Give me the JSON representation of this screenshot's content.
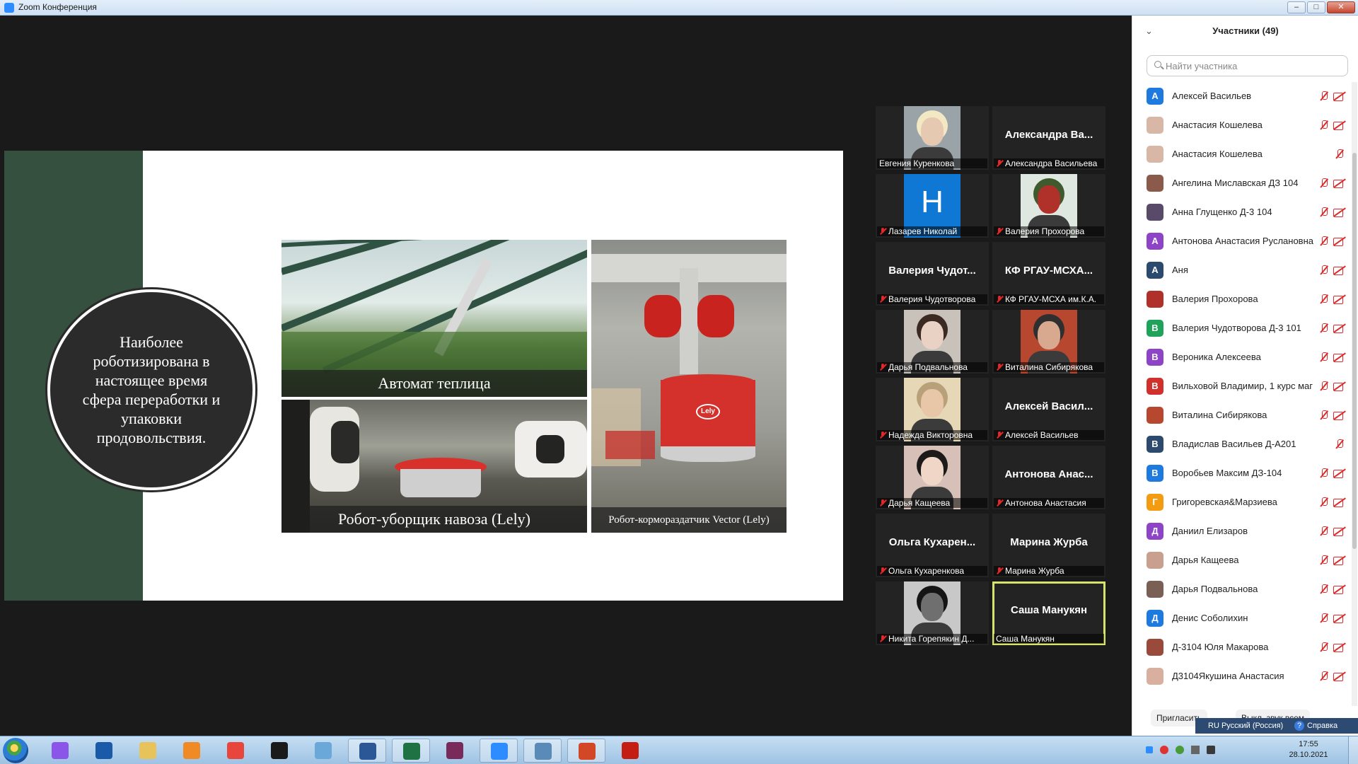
{
  "window": {
    "title": "Zoom Конференция",
    "controls": [
      "–",
      "□",
      "✕"
    ]
  },
  "slide": {
    "circle_text": "Наиболее роботизирована в настоящее время сфера переработки и упаковки продовольствия.",
    "captions": {
      "greenhouse": "Автомат теплица",
      "manure": "Робот-уборщик навоза (Lely)",
      "feeder": "Робот-кормораздатчик Vector (Lely)"
    },
    "feeder_logo": "Lely"
  },
  "gallery": [
    {
      "big": "",
      "small": "Евгения Куренкова",
      "muted": false,
      "video": true,
      "bg": "#9aa3a8",
      "face": "#e5c9b0",
      "hair": "#f2e8c4"
    },
    {
      "big": "Александра Ва...",
      "small": "Александра Васильева",
      "muted": true,
      "video": false
    },
    {
      "big": "",
      "small": "Лазарев Николай",
      "muted": true,
      "video": true,
      "letter": "H",
      "bg": "#0e78d4"
    },
    {
      "big": "",
      "small": "Валерия Прохорова",
      "muted": true,
      "video": true,
      "bg": "#dfe7e1",
      "face": "#b0312a",
      "hair": "#3f5a2c"
    },
    {
      "big": "Валерия Чудот...",
      "small": "Валерия Чудотворова",
      "muted": true,
      "video": false
    },
    {
      "big": "КФ РГАУ-МСХА...",
      "small": "КФ РГАУ-МСХА им.К.А.",
      "muted": true,
      "video": false
    },
    {
      "big": "",
      "small": "Дарья Подвальнова",
      "muted": true,
      "video": true,
      "bg": "#c9c2bb",
      "face": "#e9d2c3",
      "hair": "#3a2a22"
    },
    {
      "big": "",
      "small": "Виталина Сибирякова",
      "muted": true,
      "video": true,
      "bg": "#b7482f",
      "face": "#d8a88f",
      "hair": "#2f2f2f"
    },
    {
      "big": "",
      "small": "Надежда Викторовна",
      "muted": true,
      "video": true,
      "bg": "#e6d7b6",
      "face": "#e8c6a8",
      "hair": "#b7a07a"
    },
    {
      "big": "Алексей Васил...",
      "small": "Алексей Васильев",
      "muted": true,
      "video": false
    },
    {
      "big": "",
      "small": "Дарья Кащеева",
      "muted": true,
      "video": true,
      "bg": "#d7c0b8",
      "face": "#efd6c6",
      "hair": "#1d1a1a"
    },
    {
      "big": "Антонова Анас...",
      "small": "Антонова Анастасия",
      "muted": true,
      "video": false
    },
    {
      "big": "Ольга Кухарен...",
      "small": "Ольга Кухаренкова",
      "muted": true,
      "video": false
    },
    {
      "big": "Марина Журба",
      "small": "Марина Журба",
      "muted": true,
      "video": false
    },
    {
      "big": "",
      "small": "Никита Горепякин Д...",
      "muted": true,
      "video": true,
      "bg": "#c8c8c8",
      "face": "#6f6f6f",
      "hair": "#151515"
    },
    {
      "big": "Саша Манукян",
      "small": "Саша Манукян",
      "muted": false,
      "video": false,
      "active": true
    }
  ],
  "participants_panel": {
    "title": "Участники (49)",
    "search_placeholder": "Найти участника",
    "items": [
      {
        "initial": "А",
        "color": "#1f7ae0",
        "name": "Алексей Васильев",
        "cam_off": true
      },
      {
        "initial": "",
        "color": "#d8b7a7",
        "name": "Анастасия Кошелева",
        "cam_off": true
      },
      {
        "initial": "",
        "color": "#d8b7a7",
        "name": "Анастасия Кошелева",
        "cam_off": false
      },
      {
        "initial": "",
        "color": "#8a5a4a",
        "name": "Ангелина Миславская ДЗ 104",
        "cam_off": true
      },
      {
        "initial": "",
        "color": "#5a4a6a",
        "name": "Анна Глущенко Д-3 104",
        "cam_off": true
      },
      {
        "initial": "А",
        "color": "#8e44c6",
        "name": "Антонова Анастасия Руслановна",
        "cam_off": true
      },
      {
        "initial": "А",
        "color": "#2c4a6e",
        "name": "Аня",
        "cam_off": true
      },
      {
        "initial": "",
        "color": "#b0312a",
        "name": "Валерия Прохорова",
        "cam_off": true
      },
      {
        "initial": "В",
        "color": "#1fa25a",
        "name": "Валерия Чудотворова Д-3 101",
        "cam_off": true
      },
      {
        "initial": "В",
        "color": "#8e44c6",
        "name": "Вероника Алексеева",
        "cam_off": true
      },
      {
        "initial": "В",
        "color": "#d0312d",
        "name": "Вильховой Владимир, 1 курс маг",
        "cam_off": true
      },
      {
        "initial": "",
        "color": "#b7482f",
        "name": "Виталина Сибирякова",
        "cam_off": true
      },
      {
        "initial": "В",
        "color": "#2c4a6e",
        "name": "Владислав Васильев Д-А201",
        "cam_off": false
      },
      {
        "initial": "В",
        "color": "#1f7ae0",
        "name": "Воробьев Максим ДЗ-104",
        "cam_off": true
      },
      {
        "initial": "Г",
        "color": "#f39c12",
        "name": "Григоревская&Марзиева",
        "cam_off": true
      },
      {
        "initial": "Д",
        "color": "#8e44c6",
        "name": "Даниил Елизаров",
        "cam_off": true
      },
      {
        "initial": "",
        "color": "#c9a090",
        "name": "Дарья Кащеева",
        "cam_off": true
      },
      {
        "initial": "",
        "color": "#7a5f55",
        "name": "Дарья Подвальнова",
        "cam_off": true
      },
      {
        "initial": "Д",
        "color": "#1f7ae0",
        "name": "Денис Соболихин",
        "cam_off": true
      },
      {
        "initial": "",
        "color": "#9a4a3a",
        "name": "Д-3104 Юля Макарова",
        "cam_off": true
      },
      {
        "initial": "",
        "color": "#d9b0a0",
        "name": "Д3104Якушина Анастасия",
        "cam_off": true
      }
    ],
    "footer": {
      "invite": "Пригласить",
      "mute_all": "Выкл. звук всем"
    }
  },
  "langbar": {
    "lang": "RU Русский (Россия)",
    "help": "Справка"
  },
  "taskbar": {
    "apps": [
      {
        "name": "alice-icon",
        "color": "#8a55e8",
        "open": false
      },
      {
        "name": "grid-app-icon",
        "color": "#1b5aa8",
        "open": false
      },
      {
        "name": "folder-icon",
        "color": "#e8c25a",
        "open": false
      },
      {
        "name": "media-player-icon",
        "color": "#f08a24",
        "open": false
      },
      {
        "name": "chrome-icon",
        "color": "#e8453c",
        "open": false
      },
      {
        "name": "chart-app-icon",
        "color": "#1a1a1a",
        "open": false
      },
      {
        "name": "paint-icon",
        "color": "#69a8d8",
        "open": false
      },
      {
        "name": "word-icon",
        "color": "#2b5797",
        "open": true
      },
      {
        "name": "excel-icon",
        "color": "#1f7244",
        "open": true
      },
      {
        "name": "winrar-icon",
        "color": "#7a2a5a",
        "open": false
      },
      {
        "name": "zoom-icon",
        "color": "#2d8cff",
        "open": true
      },
      {
        "name": "window-icon",
        "color": "#5a8ab8",
        "open": true
      },
      {
        "name": "powerpoint-icon",
        "color": "#d24726",
        "open": true
      },
      {
        "name": "acrobat-icon",
        "color": "#c41e14",
        "open": false
      }
    ],
    "clock_time": "17:55",
    "clock_date": "28.10.2021"
  }
}
